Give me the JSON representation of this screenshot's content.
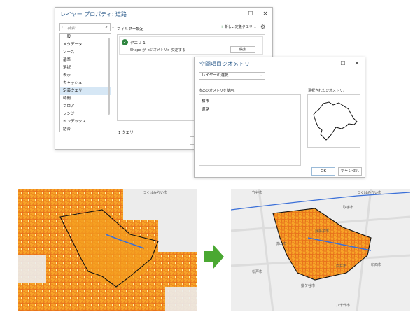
{
  "main_dialog": {
    "title": "レイヤー プロパティ: 道路",
    "search_placeholder": "検索",
    "categories": [
      "一般",
      "メタデータ",
      "ソース",
      "基準",
      "選択",
      "表示",
      "キャッシュ",
      "定義クエリ",
      "時間",
      "フロア",
      "レンジ",
      "インデックス",
      "結合"
    ],
    "selected_category": "定義クエリ",
    "filter_label": "フィルター設定",
    "new_query_label": "新しい定義クエリ",
    "query": {
      "name": "クエリ 1",
      "expression": "Shape が <ジオメトリ> 交差する",
      "edit_label": "編集"
    },
    "query_count": "1 クエリ"
  },
  "spatial_dialog": {
    "title": "空間項目ジオメトリ",
    "layer_select_label": "レイヤーの選択",
    "use_geometry_label": "次のジオメトリを使用:",
    "geometries": [
      "柏市",
      "道路"
    ],
    "selected_geometry_label": "選択されたジオメトリ:",
    "ok_label": "OK",
    "cancel_label": "キャンセル"
  },
  "maps": {
    "before_labels": [
      "つくばみらい市"
    ],
    "after_labels": [
      "守谷市",
      "つくばみらい市",
      "取手市",
      "我孫子市",
      "流山市",
      "白井市",
      "印西市",
      "鎌ケ谷市",
      "松戸市",
      "八千代市"
    ]
  },
  "colors": {
    "accent": "#2e5d8c",
    "road_fill": "#f5a623",
    "road_dark": "#e8731c",
    "arrow": "#4aa832",
    "boundary": "#111111",
    "river": "#3a6fd8"
  }
}
